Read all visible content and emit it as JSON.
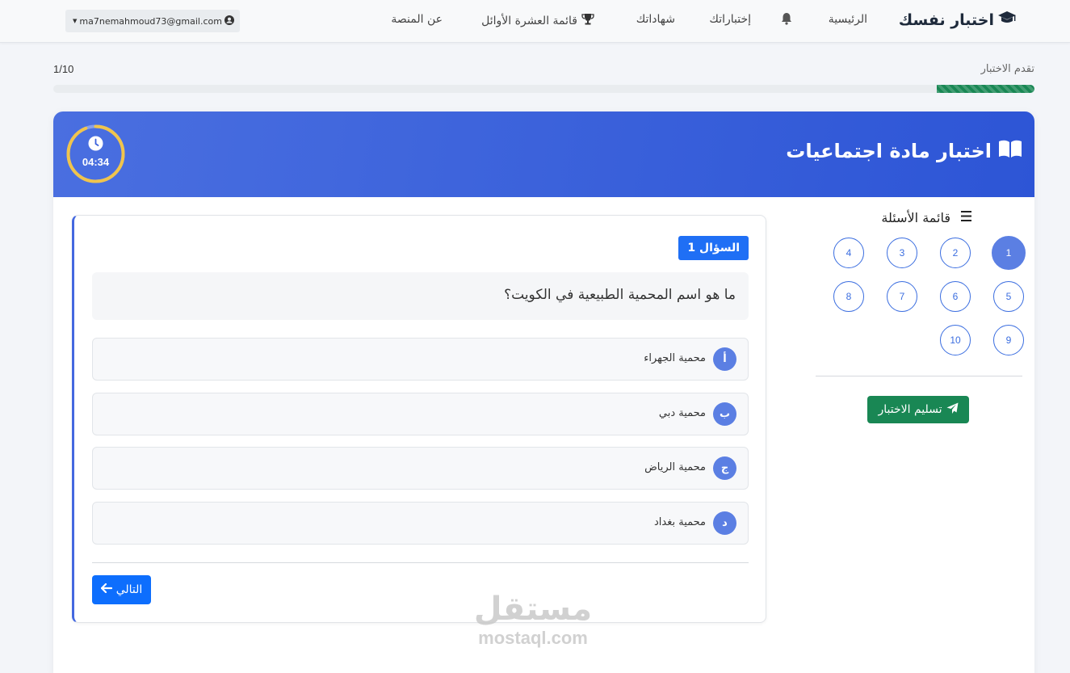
{
  "colors": {
    "accent": "#2d55d6",
    "header_gradient_start": "#4a6fe0",
    "progress": "#198754",
    "primary_button": "#0d6efd",
    "option_badge": "#5b7fe3",
    "timer_ring": "#f0c44c"
  },
  "navbar": {
    "brand": "اختبار نفسك",
    "brand_icon": "graduation-cap-icon",
    "home": "الرئيسية",
    "notification_icon": "bell-icon",
    "tests": "إختباراتك",
    "certificates": "شهاداتك",
    "leaderboard": "قائمة العشرة الأوائل",
    "leaderboard_icon": "trophy-icon",
    "about": "عن المنصة",
    "user_email": "ma7nemahmoud73@gmail.com",
    "user_icon": "user-circle-icon"
  },
  "progress": {
    "label": "تقدم الاختبار",
    "count": "1/10",
    "fraction": 0.1
  },
  "quiz": {
    "title": "اختبار مادة اجتماعيات",
    "title_icon": "book-open-icon",
    "timer": "04:34",
    "timer_icon": "clock-icon",
    "timer_fraction_remaining": 0.94
  },
  "sidebar": {
    "title": "قائمة الأسئلة",
    "title_icon": "list-ordered-icon",
    "questions": [
      "1",
      "2",
      "3",
      "4",
      "5",
      "6",
      "7",
      "8",
      "9",
      "10"
    ],
    "active": "1",
    "submit_label": "تسليم الاختبار",
    "submit_icon": "paper-plane-icon"
  },
  "question": {
    "badge": "السؤال 1",
    "text": "ما هو اسم المحمية الطبيعية في الكويت؟",
    "options": [
      {
        "letter": "أ",
        "text": "محمية الجهراء"
      },
      {
        "letter": "ب",
        "text": "محمية دبي"
      },
      {
        "letter": "ج",
        "text": "محمية الرياض"
      },
      {
        "letter": "د",
        "text": "محمية بغداد"
      }
    ],
    "next_label": "التالي",
    "next_icon": "arrow-left-icon"
  },
  "watermark": {
    "arabic": "مستقل",
    "latin": "mostaql.com"
  }
}
